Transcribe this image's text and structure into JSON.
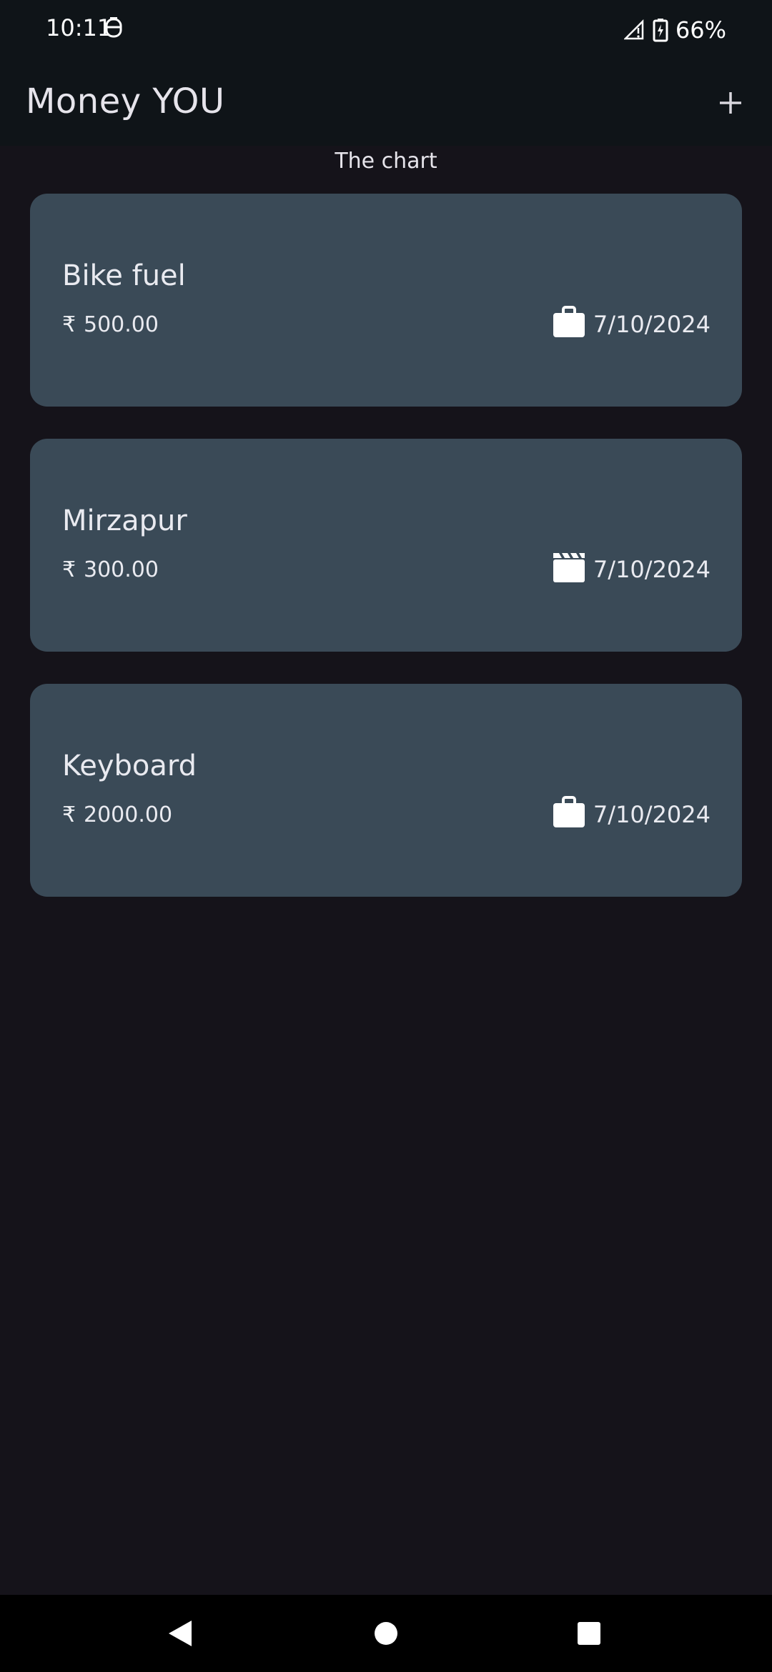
{
  "status_bar": {
    "time": "10:11",
    "battery": "66%",
    "icons": [
      "app-notification-icon",
      "signal-icon",
      "battery-charging-icon"
    ]
  },
  "app_bar": {
    "title": "Money YOU",
    "add_icon": "plus-icon"
  },
  "chart": {
    "label": "The chart"
  },
  "expenses": [
    {
      "title": "Bike fuel",
      "currency": "₹",
      "amount": "500.00",
      "category_icon": "briefcase-icon",
      "date": "7/10/2024"
    },
    {
      "title": "Mirzapur",
      "currency": "₹",
      "amount": "300.00",
      "category_icon": "clapperboard-icon",
      "date": "7/10/2024"
    },
    {
      "title": "Keyboard",
      "currency": "₹",
      "amount": "2000.00",
      "category_icon": "briefcase-icon",
      "date": "7/10/2024"
    }
  ],
  "nav_bar": {
    "buttons": [
      "back-icon",
      "home-icon",
      "recents-icon"
    ]
  },
  "colors": {
    "background": "#15131a",
    "bars": "#0f1418",
    "card": "#3a4a57",
    "text": "#e9e7ee"
  }
}
